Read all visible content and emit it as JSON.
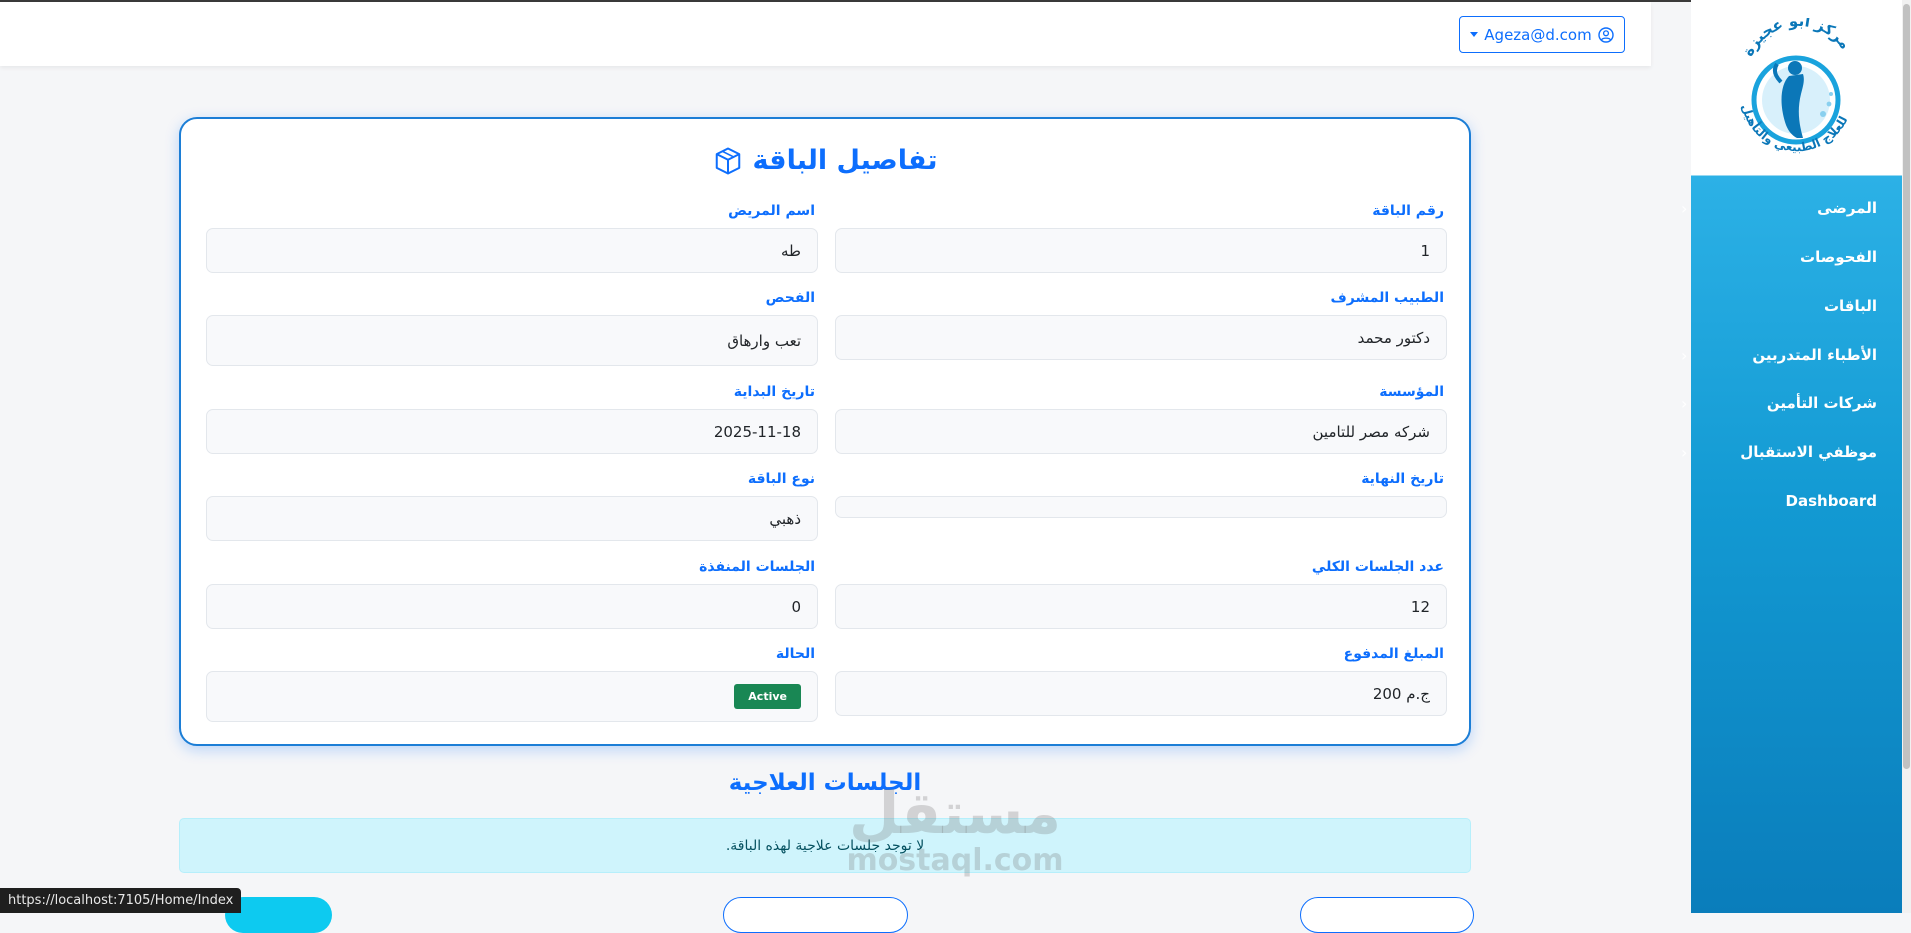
{
  "navbar": {
    "user_label": "Ageza@d.com"
  },
  "sidebar": {
    "logo_text_top": "مركز أبو عجيزة",
    "logo_text_bottom": "للعلاج الطبيعي والتأهيل",
    "items": [
      {
        "label": "المرضى",
        "has_submenu": true
      },
      {
        "label": "الفحوصات",
        "has_submenu": false
      },
      {
        "label": "الباقات",
        "has_submenu": false
      },
      {
        "label": "الأطباء المتدربين",
        "has_submenu": true
      },
      {
        "label": "شركات التأمين",
        "has_submenu": true
      },
      {
        "label": "موظفي الاستقبال",
        "has_submenu": true
      },
      {
        "label": "Dashboard",
        "has_submenu": false
      }
    ]
  },
  "card": {
    "title": "تفاصيل الباقة",
    "fields": {
      "package_number": {
        "label": "رقم الباقة",
        "value": "1"
      },
      "patient_name": {
        "label": "اسم المريض",
        "value": "طه"
      },
      "supervising_doctor": {
        "label": "الطبيب المشرف",
        "value": "دكتور محمد"
      },
      "examination": {
        "label": "الفحص",
        "value": "تعب وارهاق"
      },
      "institution": {
        "label": "المؤسسة",
        "value": "شركه مصر للتامين"
      },
      "start_date": {
        "label": "تاريخ البداية",
        "value": "2025-11-18"
      },
      "end_date": {
        "label": "تاريخ النهاية",
        "value": ""
      },
      "package_type": {
        "label": "نوع الباقة",
        "value": "ذهبي"
      },
      "total_sessions": {
        "label": "عدد الجلسات الكلي",
        "value": "12"
      },
      "completed_sessions": {
        "label": "الجلسات المنفذة",
        "value": "0"
      },
      "amount_paid": {
        "label": "المبلغ المدفوع",
        "value": "ج.م 200"
      },
      "status": {
        "label": "الحالة",
        "value": "Active"
      }
    }
  },
  "sessions": {
    "title": "الجلسات العلاجية",
    "empty_message": "لا توجد جلسات علاجية لهذه الباقة."
  },
  "watermark": {
    "arabic": "مستقل",
    "latin": "mostaql.com"
  },
  "status_bar": {
    "url": "https://localhost:7105/Home/Index"
  },
  "colors": {
    "primary": "#0d6efd",
    "success": "#198754",
    "sidebar": "#139ad3",
    "info_bg": "#cff4fc"
  }
}
